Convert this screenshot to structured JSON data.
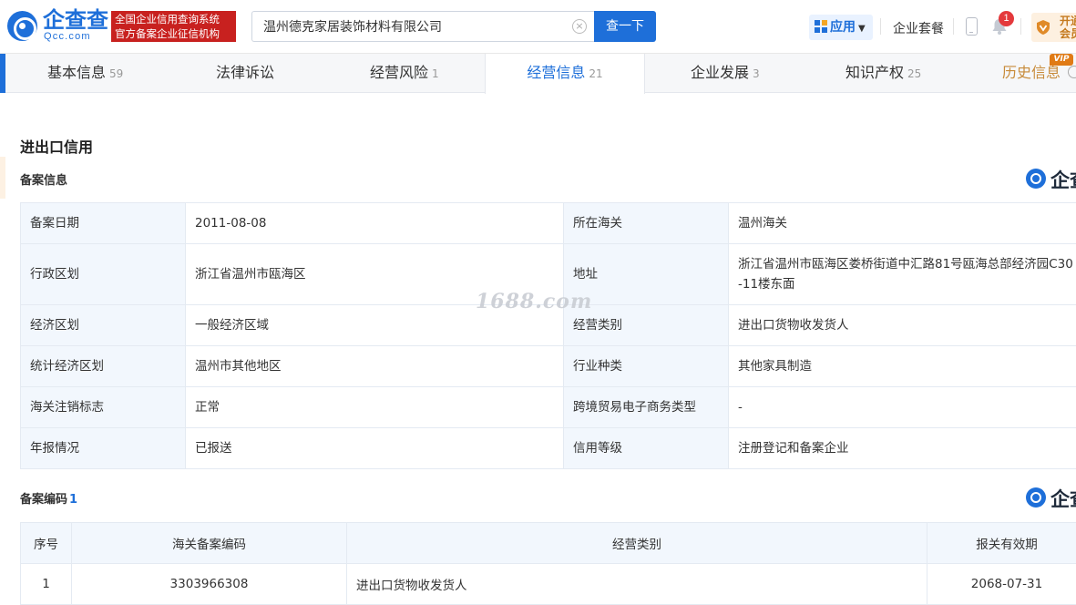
{
  "header": {
    "logo_cn": "企查查",
    "logo_en": "Qcc.com",
    "logo_tag_line1": "全国企业信用查询系统",
    "logo_tag_line2": "官方备案企业征信机构",
    "search_value": "温州德克家居装饰材料有限公司",
    "search_button": "查一下",
    "app_label": "应用",
    "package_label": "企业套餐",
    "notification_count": "1",
    "vip_text": "开通会员"
  },
  "tabs": [
    {
      "label": "基本信息",
      "count": "59"
    },
    {
      "label": "法律诉讼",
      "count": ""
    },
    {
      "label": "经营风险",
      "count": "1"
    },
    {
      "label": "经营信息",
      "count": "21"
    },
    {
      "label": "企业发展",
      "count": "3"
    },
    {
      "label": "知识产权",
      "count": "25"
    },
    {
      "label": "历史信息",
      "count": ""
    }
  ],
  "vip_tag": "VIP",
  "section_title": "进出口信用",
  "filing_info": {
    "title": "备案信息",
    "rows": [
      {
        "k1": "备案日期",
        "v1": "2011-08-08",
        "k2": "所在海关",
        "v2": "温州海关"
      },
      {
        "k1": "行政区划",
        "v1": "浙江省温州市瓯海区",
        "k2": "地址",
        "v2": "浙江省温州市瓯海区娄桥街道中汇路81号瓯海总部经济园C30-11楼东面"
      },
      {
        "k1": "经济区划",
        "v1": "一般经济区域",
        "k2": "经营类别",
        "v2": "进出口货物收发货人"
      },
      {
        "k1": "统计经济区划",
        "v1": "温州市其他地区",
        "k2": "行业种类",
        "v2": "其他家具制造"
      },
      {
        "k1": "海关注销标志",
        "v1": "正常",
        "k2": "跨境贸易电子商务类型",
        "v2": "-"
      },
      {
        "k1": "年报情况",
        "v1": "已报送",
        "k2": "信用等级",
        "v2": "注册登记和备案企业"
      }
    ]
  },
  "filing_codes": {
    "title": "备案编码",
    "count": "1",
    "headers": [
      "序号",
      "海关备案编码",
      "经营类别",
      "报关有效期"
    ],
    "rows": [
      {
        "idx": "1",
        "code": "3303966308",
        "category": "进出口货物收发货人",
        "valid": "2068-07-31"
      }
    ]
  },
  "brand_mark": "企查查",
  "watermark": "1688.com",
  "colors": {
    "accent": "#1e6fd9",
    "tag_red": "#c8211f",
    "vip_orange": "#e07b16"
  }
}
